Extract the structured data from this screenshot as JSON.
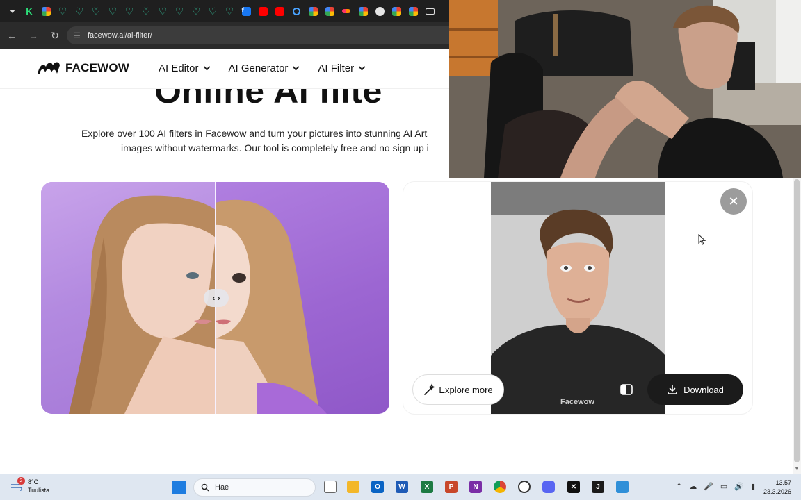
{
  "browser": {
    "url": "facewow.ai/ai-filter/",
    "tab_favicons": [
      "tab-list-icon",
      "kick-icon",
      "google-icon",
      "heart-icon",
      "heart-icon",
      "heart-icon",
      "heart-icon",
      "heart-icon",
      "heart-icon",
      "heart-icon",
      "heart-icon",
      "heart-icon",
      "heart-icon",
      "heart-icon",
      "facebook-icon",
      "youtube-icon",
      "youtube-icon",
      "lens-icon",
      "google-icon",
      "google-icon",
      "flickr-icon",
      "google-icon",
      "github-icon",
      "google-icon",
      "google-icon",
      "keyboard-icon"
    ]
  },
  "site": {
    "logo_text": "FACEWOW",
    "nav": [
      {
        "label": "AI Editor"
      },
      {
        "label": "AI Generator"
      },
      {
        "label": "AI Filter"
      }
    ]
  },
  "hero": {
    "title": "Online AI filte",
    "desc_line1": "Explore over 100 AI filters in Facewow and turn your pictures into stunning AI Art",
    "desc_line2": "images without watermarks. Our tool is completely free and no sign up i"
  },
  "result_card": {
    "watermark": "Facewow",
    "explore_label": "Explore more",
    "download_label": "Download"
  },
  "taskbar": {
    "temperature": "8°C",
    "weather": "Tuulista",
    "weather_badge": "2",
    "search_placeholder": "Hae",
    "time": "13.57",
    "date": "23.3.2026"
  },
  "colors": {
    "accent_dark": "#1b1b1b",
    "photo_background": "#b485e0",
    "browser_bg": "#1f1f1f"
  }
}
